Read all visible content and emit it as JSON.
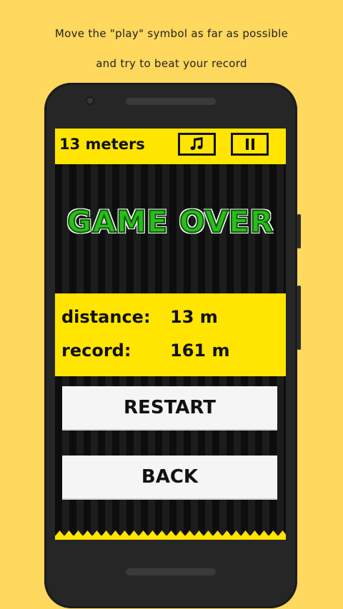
{
  "caption": {
    "line1": "Move the \"play\" symbol as far as possible",
    "line2": "and try to beat your record"
  },
  "hud": {
    "distance_text": "13 meters",
    "music_icon": "music-note-icon",
    "pause_icon": "pause-icon"
  },
  "title": "GAME OVER",
  "stats": {
    "distance_label": "distance:",
    "distance_value": "13 m",
    "record_label": "record:",
    "record_value": "161 m"
  },
  "buttons": {
    "restart": "RESTART",
    "back": "BACK"
  },
  "colors": {
    "background": "#FFD85E",
    "hud_yellow": "#FFE500",
    "title_green": "#2BBD1D",
    "phone_body": "#262626"
  }
}
